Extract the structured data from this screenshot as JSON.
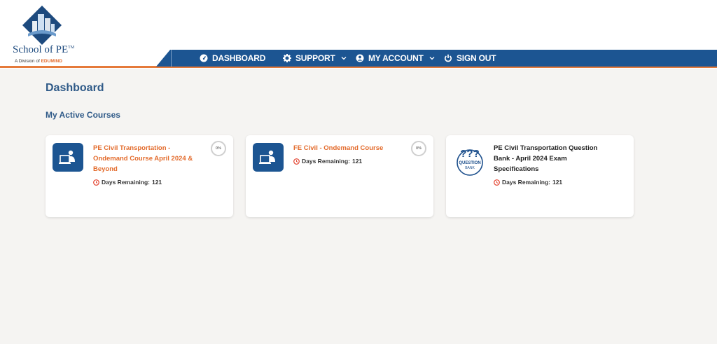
{
  "logo": {
    "name": "School of PE",
    "trademark": "TM",
    "sub_prefix": "A Division of",
    "sub_brand": "EDUMIND"
  },
  "nav": {
    "items": [
      {
        "label": "DASHBOARD",
        "icon": "dashboard-icon"
      },
      {
        "label": "SUPPORT",
        "icon": "gear-icon",
        "dropdown": true
      },
      {
        "label": "MY ACCOUNT",
        "icon": "user-icon",
        "dropdown": true
      },
      {
        "label": "SIGN OUT",
        "icon": "power-icon"
      }
    ]
  },
  "main": {
    "title": "Dashboard",
    "section_title": "My Active Courses",
    "courses": [
      {
        "title": "PE Civil Transportation - Ondemand Course April 2024 & Beyond",
        "days_label": "Days Remaining:",
        "days_value": "121",
        "progress": "0%",
        "icon": "laptop-user-icon"
      },
      {
        "title": "FE Civil - Ondemand Course",
        "days_label": "Days Remaining:",
        "days_value": "121",
        "progress": "0%",
        "icon": "laptop-user-icon"
      },
      {
        "title": "PE Civil Transportation Question Bank - April 2024 Exam Specifications",
        "days_label": "Days Remaining:",
        "days_value": "121",
        "icon": "question-bank-icon",
        "icon_text_top": "QUESTION",
        "icon_text_bottom": "BANK"
      }
    ]
  },
  "colors": {
    "nav_blue": "#1c5592",
    "accent_orange": "#e36b2c",
    "title_blue": "#2f5a88",
    "background": "#f5f4f2"
  }
}
